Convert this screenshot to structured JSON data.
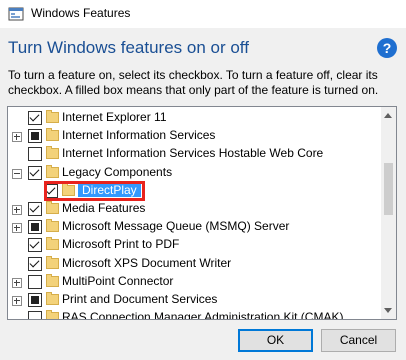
{
  "window": {
    "title": "Windows Features"
  },
  "header": {
    "heading": "Turn Windows features on or off",
    "description": "To turn a feature on, select its checkbox. To turn a feature off, clear its checkbox. A filled box means that only part of the feature is turned on."
  },
  "tree": {
    "items": [
      {
        "label": "Internet Explorer 11",
        "state": "checked",
        "expandable": false
      },
      {
        "label": "Internet Information Services",
        "state": "partial",
        "expandable": true
      },
      {
        "label": "Internet Information Services Hostable Web Core",
        "state": "unchecked",
        "expandable": false
      },
      {
        "label": "Legacy Components",
        "state": "checked",
        "expandable": true,
        "expanded": true
      },
      {
        "label": "DirectPlay",
        "state": "checked",
        "expandable": false,
        "child": true,
        "selected": true
      },
      {
        "label": "Media Features",
        "state": "checked",
        "expandable": true
      },
      {
        "label": "Microsoft Message Queue (MSMQ) Server",
        "state": "partial",
        "expandable": true
      },
      {
        "label": "Microsoft Print to PDF",
        "state": "checked",
        "expandable": false
      },
      {
        "label": "Microsoft XPS Document Writer",
        "state": "checked",
        "expandable": false
      },
      {
        "label": "MultiPoint Connector",
        "state": "unchecked",
        "expandable": true
      },
      {
        "label": "Print and Document Services",
        "state": "partial",
        "expandable": true
      },
      {
        "label": "RAS Connection Manager Administration Kit (CMAK)",
        "state": "unchecked",
        "expandable": false
      }
    ]
  },
  "buttons": {
    "ok": "OK",
    "cancel": "Cancel"
  },
  "colors": {
    "heading": "#1a4f94",
    "selection": "#3399ff",
    "annotation": "#e8231e"
  }
}
